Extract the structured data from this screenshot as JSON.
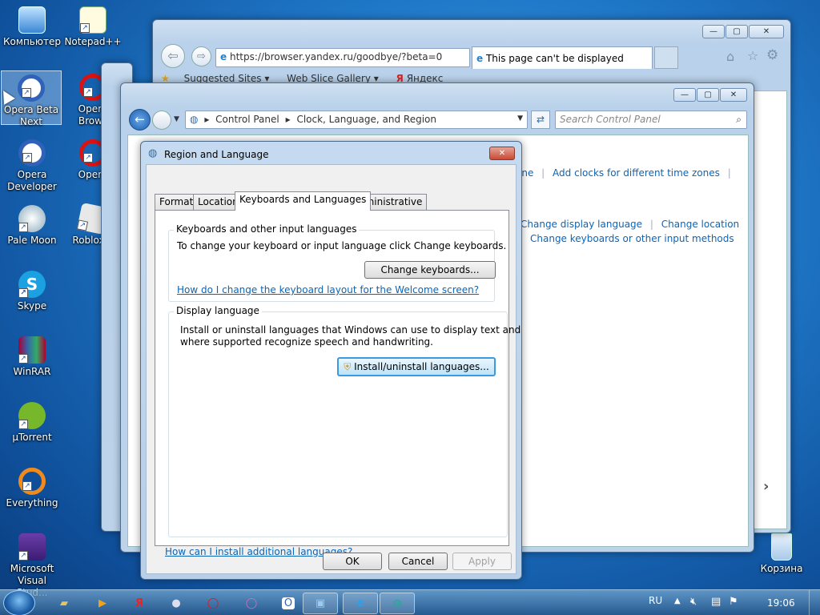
{
  "desktop": {
    "icons": [
      {
        "label": "Компьютер"
      },
      {
        "label": "Notepad++"
      },
      {
        "label": "Opera Beta Next"
      },
      {
        "label": "Opera Brows"
      },
      {
        "label": "Opera Developer"
      },
      {
        "label": "Opera"
      },
      {
        "label": "Pale Moon"
      },
      {
        "label": "Roblox P"
      },
      {
        "label": "Skype"
      },
      {
        "label": "WinRAR"
      },
      {
        "label": "µTorrent"
      },
      {
        "label": "Everything"
      },
      {
        "label": "Microsoft Visual Stud..."
      },
      {
        "label": "Корзина"
      }
    ]
  },
  "browser": {
    "address": "https://browser.yandex.ru/goodbye/?beta=0",
    "address_domain": "yandex",
    "tab_title": "This page can't be displayed",
    "favorites": [
      "Suggested Sites",
      "Web Slice Gallery",
      "Яндекс"
    ]
  },
  "control_panel": {
    "breadcrumb": [
      "Control Panel",
      "Clock, Language, and Region"
    ],
    "search_placeholder": "Search Control Panel",
    "links_row1": [
      "one",
      "Add clocks for different time zones"
    ],
    "links_row2": [
      "Change display language",
      "Change location"
    ],
    "links_row3": [
      "Change keyboards or other input methods"
    ]
  },
  "dialog": {
    "title": "Region and Language",
    "tabs": [
      "Formats",
      "Location",
      "Keyboards and Languages",
      "Administrative"
    ],
    "active_tab": "Keyboards and Languages",
    "group1_title": "Keyboards and other input languages",
    "group1_text": "To change your keyboard or input language click Change keyboards.",
    "change_keyboards_btn": "Change keyboards...",
    "group1_link": "How do I change the keyboard layout for the Welcome screen?",
    "group2_title": "Display language",
    "group2_text1": "Install or uninstall languages that Windows can use to display text and",
    "group2_text2": "where supported recognize speech and handwriting.",
    "install_btn": "Install/uninstall languages...",
    "bottom_link": "How can I install additional languages?",
    "ok": "OK",
    "cancel": "Cancel",
    "apply": "Apply"
  },
  "taskbar": {
    "lang": "RU",
    "clock": "19:06"
  }
}
